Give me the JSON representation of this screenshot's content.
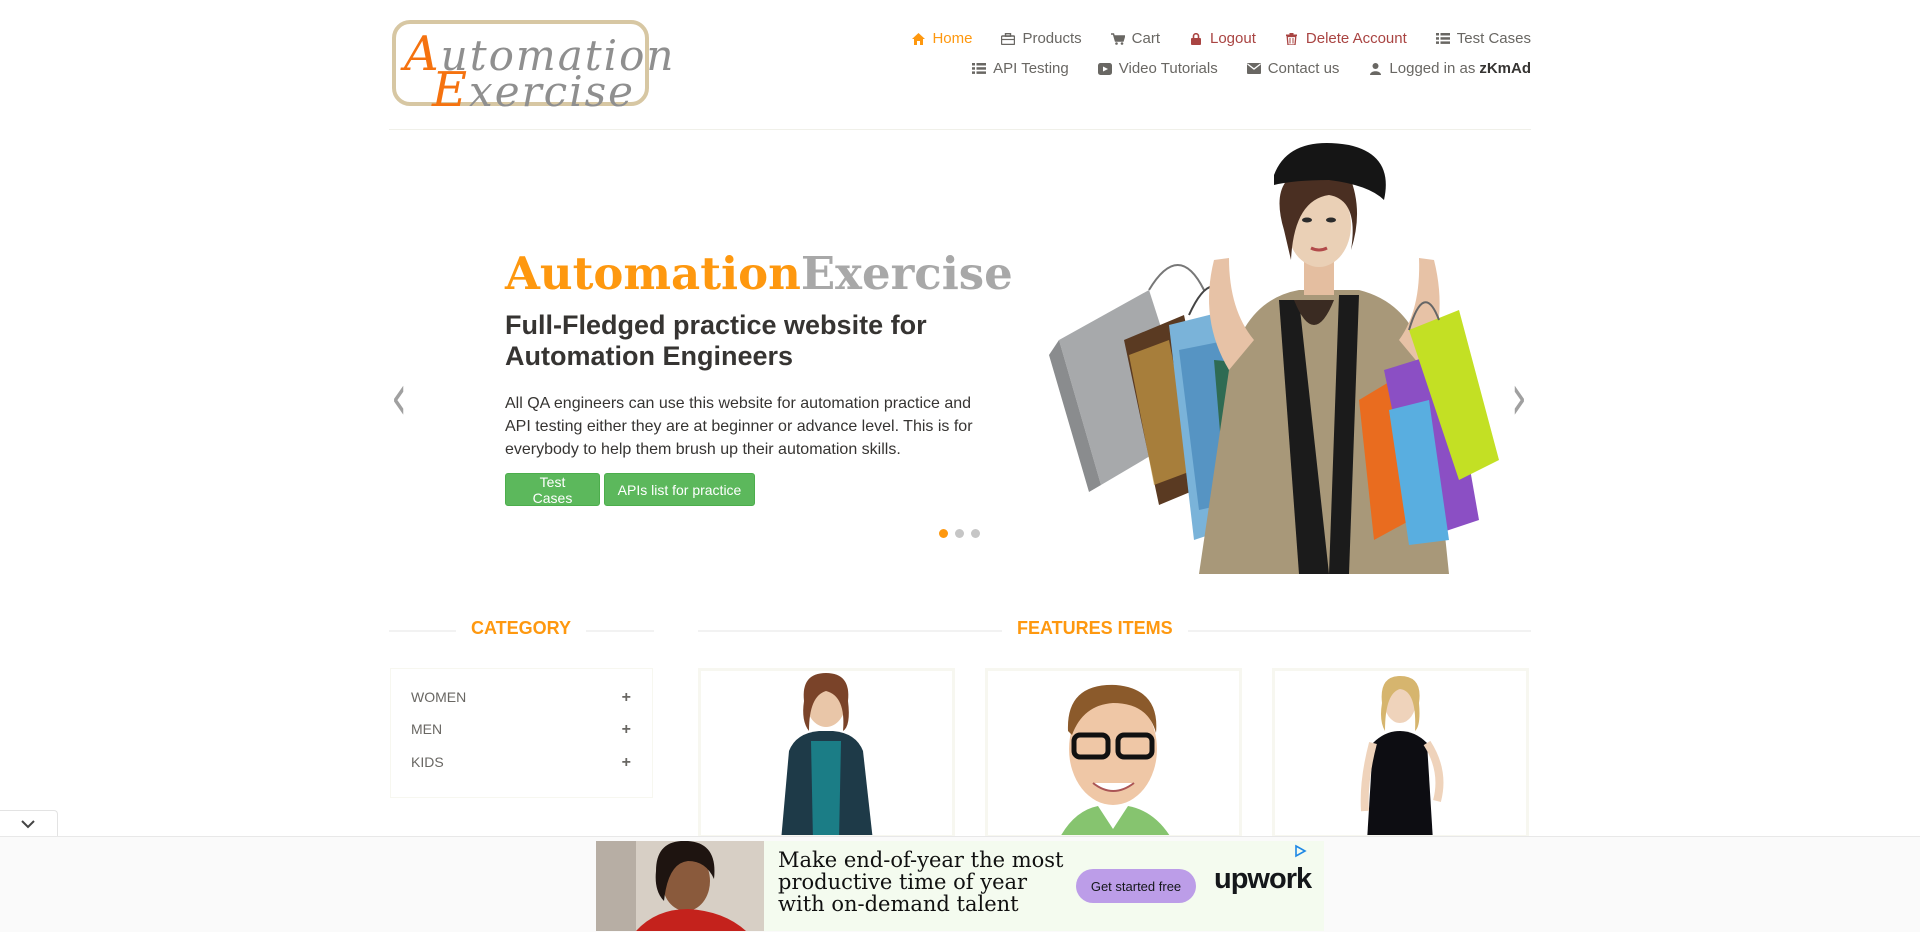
{
  "header": {
    "logo_line1": "utomation",
    "logo_line1_cap": "A",
    "logo_line2": "xercise",
    "logo_line2_cap": "E",
    "nav_row1": [
      {
        "label": "Home",
        "icon": "home-icon"
      },
      {
        "label": "Products",
        "icon": "briefcase-icon"
      },
      {
        "label": "Cart",
        "icon": "cart-icon"
      },
      {
        "label": "Logout",
        "icon": "lock-icon"
      },
      {
        "label": "Delete Account",
        "icon": "trash-icon"
      },
      {
        "label": "Test Cases",
        "icon": "list-icon"
      }
    ],
    "nav_row2": [
      {
        "label": "API Testing",
        "icon": "list-icon"
      },
      {
        "label": "Video Tutorials",
        "icon": "youtube-icon"
      },
      {
        "label": "Contact us",
        "icon": "envelope-icon"
      },
      {
        "label": "Logged in as",
        "icon": "user-icon"
      }
    ],
    "username": "zKmAd"
  },
  "slider": {
    "brand_orange": "Automation",
    "brand_gray": "Exercise",
    "headline": "Full-Fledged practice website for Automation Engineers",
    "description": "All QA engineers can use this website for automation practice and API testing either they are at beginner or advance level. This is for everybody to help them brush up their automation skills.",
    "button1": "Test Cases",
    "button2": "APIs list for practice",
    "prev_arrow": "‹",
    "next_arrow": "›"
  },
  "category": {
    "title": "CATEGORY",
    "items": [
      "WOMEN",
      "MEN",
      "KIDS"
    ],
    "plus": "+"
  },
  "features": {
    "title": "FEATURES ITEMS"
  },
  "ad": {
    "text": "Make end-of-year the most productive time of year with on-demand talent",
    "button": "Get started free",
    "brand": "upwork"
  },
  "colors": {
    "accent": "#fe980f",
    "button_green": "#5cb85c",
    "danger": "#a94442",
    "text": "#696763"
  }
}
